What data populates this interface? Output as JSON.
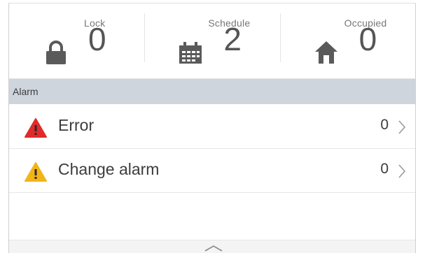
{
  "stats": [
    {
      "id": "lock",
      "label": "Lock",
      "count": "0",
      "icon": "lock-icon"
    },
    {
      "id": "schedule",
      "label": "Schedule",
      "count": "2",
      "icon": "calendar-icon"
    },
    {
      "id": "occupied",
      "label": "Occupied",
      "count": "0",
      "icon": "home-icon"
    }
  ],
  "alarm_section": {
    "title": "Alarm",
    "items": [
      {
        "id": "error",
        "label": "Error",
        "count": "0",
        "icon": "warning-red-icon",
        "color": "#e02b2b"
      },
      {
        "id": "change",
        "label": "Change alarm",
        "count": "0",
        "icon": "warning-yellow-icon",
        "color": "#f2b418"
      }
    ]
  },
  "colors": {
    "header_bg": "#cfd5dc",
    "error_red": "#e02b2b",
    "warning_yellow": "#f2b418",
    "icon_gray": "#5a5a5a"
  }
}
